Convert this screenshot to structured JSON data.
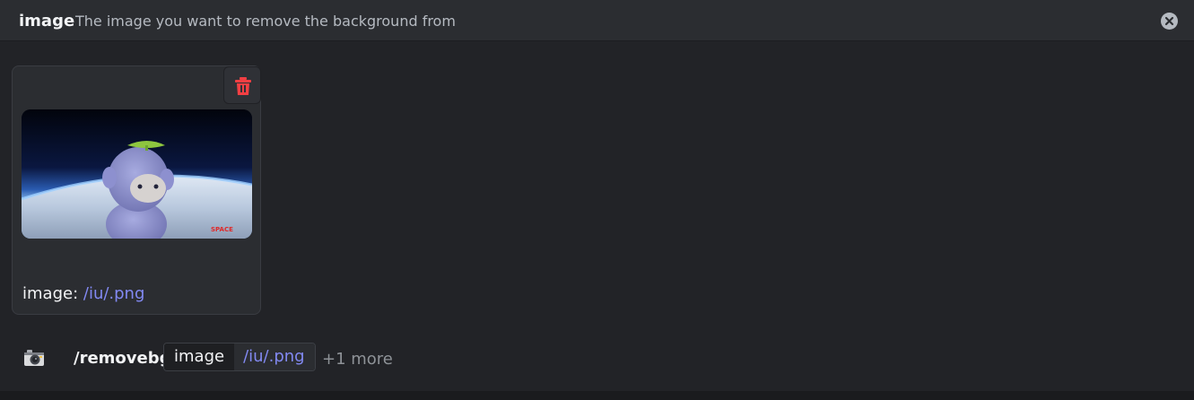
{
  "option": {
    "name": "image",
    "description": "The image you want to remove the background from"
  },
  "attachment": {
    "label": "image:",
    "value": "/iu/.png",
    "watermark": "SPACE"
  },
  "command": {
    "name": "/removebg",
    "param_name": "image",
    "param_value": "/iu/.png",
    "more": "+1 more"
  },
  "icons": {
    "close": "close-circle-icon",
    "delete": "trash-icon",
    "command": "camera-icon"
  },
  "colors": {
    "accent_link": "#8289f2",
    "delete_red": "#f23f43"
  }
}
